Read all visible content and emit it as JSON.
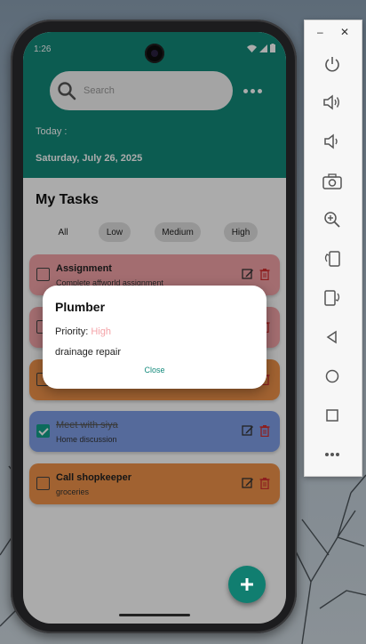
{
  "status_bar": {
    "time": "1:26"
  },
  "search": {
    "placeholder": "Search"
  },
  "header": {
    "today_label": "Today :",
    "date": "Saturday, July 26, 2025"
  },
  "main": {
    "title": "My Tasks"
  },
  "filters": [
    "All",
    "Low",
    "Medium",
    "High"
  ],
  "tasks": [
    {
      "title": "Assignment",
      "subtitle": "Complete affworld assignment",
      "completed": false,
      "color": "#f4a3a8"
    },
    {
      "title": "",
      "subtitle": "",
      "completed": false,
      "color": "#f4a3a8"
    },
    {
      "title": "",
      "subtitle": "",
      "completed": false,
      "color": "#f0934a"
    },
    {
      "title": "Meet with siya",
      "subtitle": "Home discussion",
      "completed": true,
      "color": "#7f9fe8"
    },
    {
      "title": "Call shopkeeper",
      "subtitle": "groceries",
      "completed": false,
      "color": "#f0934a"
    }
  ],
  "dialog": {
    "title": "Plumber",
    "priority_label": "Priority:",
    "priority_value": "High",
    "description": "drainage repair",
    "close_label": "Close"
  },
  "colors": {
    "header": "#12897a",
    "fab": "#117e70",
    "accent": "#138a7c",
    "high_priority": "#f4a3a8"
  },
  "emulator_toolbar": {
    "window_controls": [
      "minimize-icon",
      "close-icon"
    ],
    "tools": [
      "power-icon",
      "volume-up-icon",
      "volume-down-icon",
      "camera-icon",
      "zoom-icon",
      "rotate-left-icon",
      "rotate-right-icon",
      "back-icon",
      "home-icon",
      "overview-icon",
      "more-icon"
    ]
  }
}
